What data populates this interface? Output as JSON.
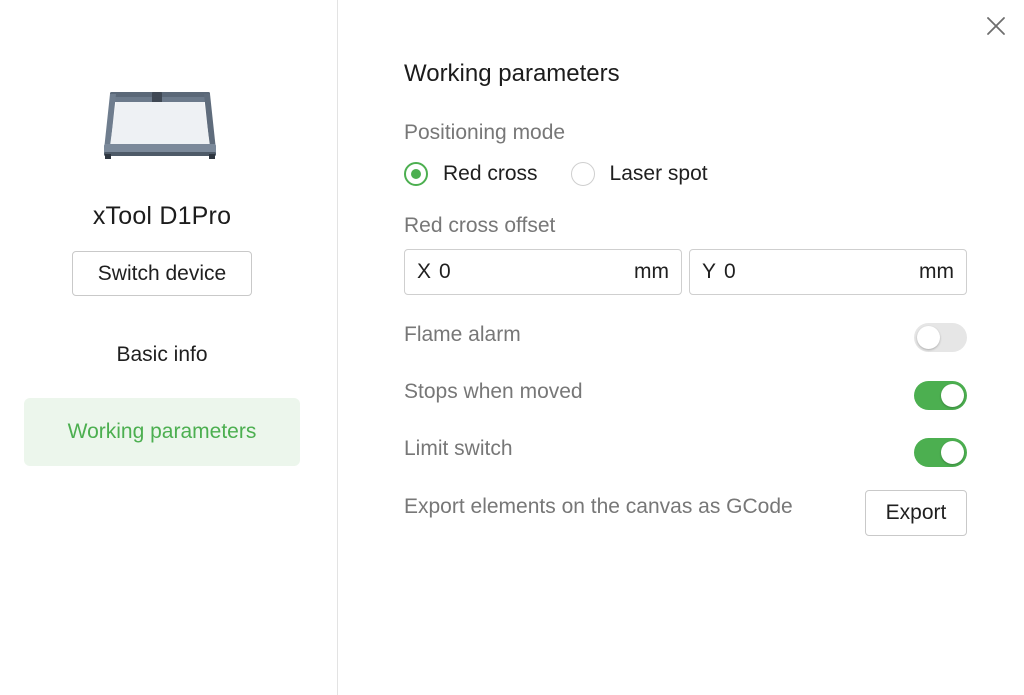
{
  "sidebar": {
    "device_name": "xTool D1Pro",
    "switch_device_label": "Switch device",
    "nav": [
      {
        "label": "Basic info",
        "active": false
      },
      {
        "label": "Working parameters",
        "active": true
      }
    ]
  },
  "main": {
    "title": "Working parameters",
    "positioning_mode": {
      "label": "Positioning mode",
      "options": [
        {
          "label": "Red cross",
          "selected": true
        },
        {
          "label": "Laser spot",
          "selected": false
        }
      ]
    },
    "red_cross_offset": {
      "label": "Red cross offset",
      "x": {
        "axis": "X",
        "value": "0",
        "unit": "mm"
      },
      "y": {
        "axis": "Y",
        "value": "0",
        "unit": "mm"
      }
    },
    "flame_alarm": {
      "label": "Flame alarm",
      "enabled": false
    },
    "stops_when_moved": {
      "label": "Stops when moved",
      "enabled": true
    },
    "limit_switch": {
      "label": "Limit switch",
      "enabled": true
    },
    "export": {
      "label": "Export elements on the canvas as GCode",
      "button_label": "Export"
    }
  },
  "colors": {
    "accent": "#4caf50",
    "active_nav_bg": "#ecf6ec",
    "toggle_off": "#e6e6e6",
    "muted_text": "#777777"
  },
  "icons": {
    "close": "close-icon",
    "device": "laser-engraver-icon"
  }
}
